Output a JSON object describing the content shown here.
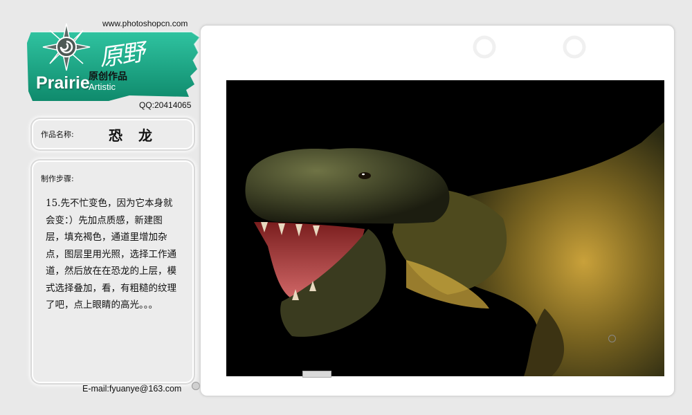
{
  "header": {
    "site_url": "www.photoshopcn.com",
    "logo_script": "原野",
    "logo_en": "Prairie",
    "logo_sub_cn": "原创作品",
    "logo_sub_en": "Artistic",
    "qq": "QQ:20414065"
  },
  "work": {
    "name_label": "作品名称:",
    "name_value": "恐 龙",
    "steps_label": "制作步骤:",
    "steps_text": "15.先不忙变色，因为它本身就会变：）先加点质感，新建图层，填充褐色，通道里增加杂点，图层里用光照，选择工作通道，然后放在在恐龙的上层，模式选择叠加，看，有粗糙的纹理了吧，点上眼睛的高光。。。"
  },
  "footer": {
    "email": "E-mail:fyuanye@163.com"
  },
  "colors": {
    "banner_green": "#1fae8c",
    "background": "#e9e9e9",
    "artwork_bg": "#000000"
  }
}
